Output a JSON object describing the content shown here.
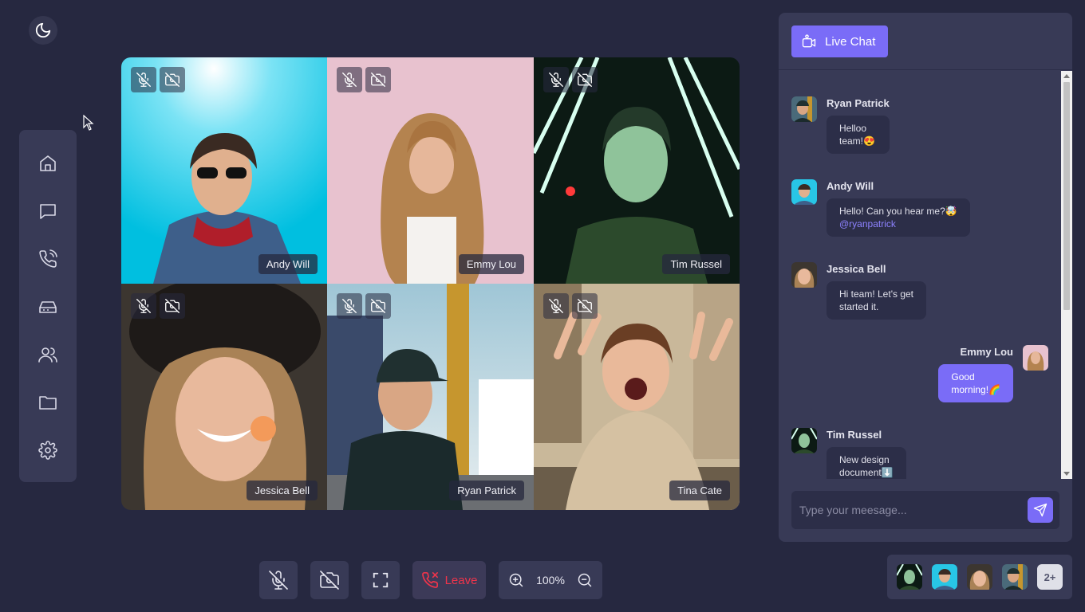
{
  "theme_toggle": {
    "icon": "moon-icon"
  },
  "sidebar": {
    "items": [
      {
        "name": "home",
        "icon": "home-icon"
      },
      {
        "name": "messages",
        "icon": "message-icon"
      },
      {
        "name": "calls",
        "icon": "phone-call-icon"
      },
      {
        "name": "storage",
        "icon": "inbox-icon"
      },
      {
        "name": "contacts",
        "icon": "users-icon"
      },
      {
        "name": "files",
        "icon": "folder-icon"
      },
      {
        "name": "settings",
        "icon": "gear-icon"
      }
    ]
  },
  "video_tiles": [
    {
      "name": "Andy Will"
    },
    {
      "name": "Emmy Lou"
    },
    {
      "name": "Tim Russel"
    },
    {
      "name": "Jessica Bell"
    },
    {
      "name": "Ryan Patrick"
    },
    {
      "name": "Tina Cate"
    }
  ],
  "controls": {
    "leave_label": "Leave",
    "zoom_value": "100%"
  },
  "chat": {
    "header_label": "Live Chat",
    "messages": [
      {
        "author": "Ryan Patrick",
        "lines": [
          "Helloo",
          "team!😍"
        ]
      },
      {
        "author": "Andy Will",
        "lines": [
          "Hello! Can you hear me?🤯"
        ],
        "mention": "@ryanpatrick"
      },
      {
        "author": "Jessica Bell",
        "lines": [
          "Hi team! Let's get",
          "started it."
        ]
      },
      {
        "author": "Emmy Lou",
        "lines": [
          "Good",
          "morning!🌈"
        ],
        "self": true
      },
      {
        "author": "Tim Russel",
        "lines": [
          "New design",
          "document⬇️"
        ]
      }
    ],
    "input_placeholder": "Type your meesage..."
  },
  "participants": {
    "more_label": "2+"
  },
  "colors": {
    "background": "#262840",
    "panel": "#383a56",
    "accent": "#7a6cf7",
    "leave": "#f0344b"
  }
}
